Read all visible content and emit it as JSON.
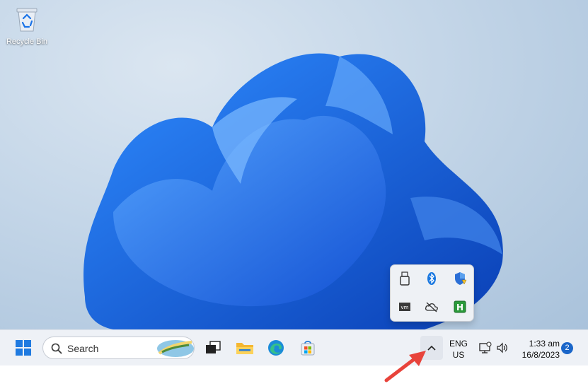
{
  "desktop": {
    "recycle_bin_label": "Recycle Bin"
  },
  "taskbar": {
    "search_label": "Search",
    "language_line1": "ENG",
    "language_line2": "US",
    "time": "1:33 am",
    "date": "16/8/2023",
    "notification_count": "2"
  },
  "tray_flyout": {
    "icons": [
      "usb-drive-icon",
      "bluetooth-icon",
      "windows-security-warning-icon",
      "vmware-icon",
      "onedrive-offline-icon",
      "hwinfo-icon"
    ]
  },
  "colors": {
    "accent": "#1a66c9",
    "taskbar_bg": "#eef1f6",
    "annotation_arrow": "#e8433b"
  }
}
